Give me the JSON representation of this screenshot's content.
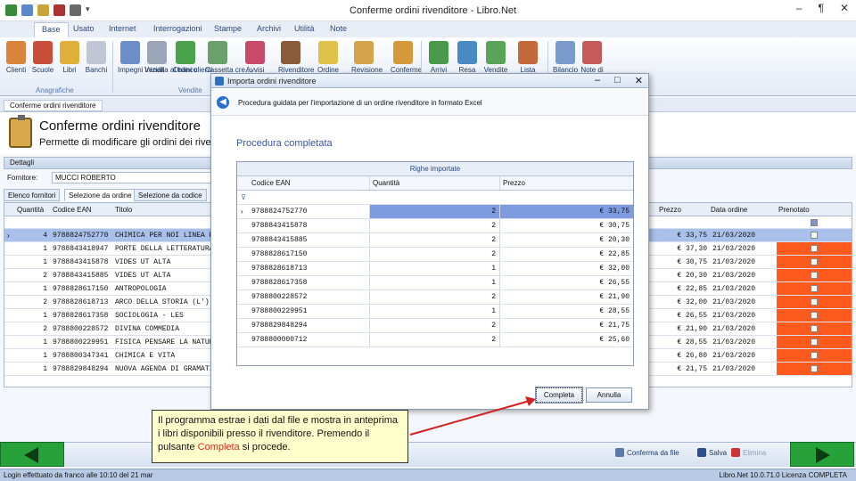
{
  "window": {
    "title": "Conferme ordini rivenditore - Libro.Net",
    "controls": [
      "–",
      "¶",
      "✕"
    ]
  },
  "ribbon": {
    "tabs": [
      "Base",
      "Usato",
      "Internet",
      "Interrogazioni",
      "Stampe",
      "Archivi",
      "Utilità",
      "Note"
    ],
    "groups": [
      {
        "label": "Anagrafiche",
        "buttons": [
          "Clienti",
          "Scuole",
          "Libri",
          "Banchi"
        ]
      },
      {
        "label": "Vendite",
        "buttons": [
          "Impegni iniziali",
          "Vendita al banco",
          "Ordini clienti",
          "Cassetta cre…",
          "Avvisi",
          "Rivenditore",
          "Ordine",
          "Revisione",
          "Conferme"
        ]
      },
      {
        "label": "",
        "buttons": [
          "Arrivi",
          "Resa",
          "Vendite",
          "Lista"
        ]
      },
      {
        "label": "",
        "buttons": [
          "Bilancio",
          "Note di"
        ]
      }
    ]
  },
  "doc_tab": "Conferme ordini rivenditore",
  "header": {
    "title": "Conferme ordini rivenditore",
    "subtitle": "Permette di modificare gli ordini dei rivenditori"
  },
  "details": {
    "section_label": "Dettagli",
    "fornitore_label": "Fornitore:",
    "fornitore_value": "MUCCI ROBERTO",
    "subtabs": [
      "Elenco fornitori",
      "Selezione da ordine",
      "Selezione da codice"
    ]
  },
  "main_grid": {
    "headers": [
      "Quantità",
      "Codice EAN",
      "Titolo",
      "Prezzo",
      "Data ordine",
      "Prenotato"
    ],
    "rows": [
      {
        "q": "4",
        "ean": "9788824752770",
        "title": "CHIMICA PER NOI LINEA BLU",
        "price": "€ 33,75",
        "date": "21/03/2020",
        "pren": false,
        "sel": true
      },
      {
        "q": "1",
        "ean": "9788843418947",
        "title": "PORTE DELLA LETTERATURA",
        "price": "€ 37,30",
        "date": "21/03/2020",
        "pren": true,
        "sel": false
      },
      {
        "q": "1",
        "ean": "9788843415878",
        "title": "VIDES UT ALTA",
        "price": "€ 30,75",
        "date": "21/03/2020",
        "pren": true,
        "sel": false
      },
      {
        "q": "2",
        "ean": "9788843415885",
        "title": "VIDES UT ALTA",
        "price": "€ 20,30",
        "date": "21/03/2020",
        "pren": true,
        "sel": false
      },
      {
        "q": "1",
        "ean": "9788828617150",
        "title": "ANTROPOLOGIA",
        "price": "€ 22,85",
        "date": "21/03/2020",
        "pren": true,
        "sel": false
      },
      {
        "q": "2",
        "ean": "9788828618713",
        "title": "ARCO DELLA STORIA (L')",
        "price": "€ 32,00",
        "date": "21/03/2020",
        "pren": true,
        "sel": false
      },
      {
        "q": "1",
        "ean": "9788828617358",
        "title": "SOCIOLOGIA - LES",
        "price": "€ 26,55",
        "date": "21/03/2020",
        "pren": true,
        "sel": false
      },
      {
        "q": "2",
        "ean": "9788800228572",
        "title": "DIVINA COMMEDIA",
        "price": "€ 21,90",
        "date": "21/03/2020",
        "pren": true,
        "sel": false
      },
      {
        "q": "1",
        "ean": "9788800229951",
        "title": "FISICA PENSARE LA NATURA",
        "price": "€ 28,55",
        "date": "21/03/2020",
        "pren": true,
        "sel": false
      },
      {
        "q": "1",
        "ean": "9788800347341",
        "title": "CHIMICA E VITA",
        "price": "€ 26,80",
        "date": "21/03/2020",
        "pren": true,
        "sel": false
      },
      {
        "q": "1",
        "ean": "9788829848294",
        "title": "NUOVA AGENDA DI GRAMATICA",
        "price": "€ 21,75",
        "date": "21/03/2020",
        "pren": true,
        "sel": false
      }
    ]
  },
  "modal": {
    "title": "Importa ordini rivenditore",
    "controls": [
      "–",
      "□",
      "✕"
    ],
    "wizard_text": "Procedura guidata per l'importazione di un ordine rivenditore in formato Excel",
    "status": "Procedura completata",
    "grid_band": "Righe importate",
    "headers": [
      "Codice EAN",
      "Quantità",
      "Prezzo"
    ],
    "rows": [
      {
        "ean": "9788824752770",
        "q": "2",
        "p": "€ 33,75"
      },
      {
        "ean": "9788843415878",
        "q": "2",
        "p": "€ 30,75"
      },
      {
        "ean": "9788843415885",
        "q": "2",
        "p": "€ 20,30"
      },
      {
        "ean": "9788828617150",
        "q": "2",
        "p": "€ 22,85"
      },
      {
        "ean": "9788828618713",
        "q": "1",
        "p": "€ 32,00"
      },
      {
        "ean": "9788828617358",
        "q": "1",
        "p": "€ 26,55"
      },
      {
        "ean": "9788800228572",
        "q": "2",
        "p": "€ 21,90"
      },
      {
        "ean": "9788800229951",
        "q": "1",
        "p": "€ 28,55"
      },
      {
        "ean": "9788829848294",
        "q": "2",
        "p": "€ 21,75"
      },
      {
        "ean": "9788800000712",
        "q": "2",
        "p": "€ 25,60"
      }
    ],
    "ok_button": "Completa",
    "cancel_button": "Annulla"
  },
  "bottom_toolbar": {
    "conferma": "Conferma da file",
    "salva": "Salva",
    "elimina": "Elimina"
  },
  "status_bar": {
    "left": "Login effettuato da franco alle 10:10 del 21 mar",
    "right": "Libro.Net 10.0.71.0 Licenza COMPLETA"
  },
  "callout": {
    "text_before": "Il programma estrae i dati dal file e mostra in anteprima i libri disponibili presso il rivenditore. Premendo il pulsante ",
    "highlight": "Completa",
    "text_after": " si procede."
  },
  "colors": {
    "accent": "#2f6fbf",
    "selected_row": "#a9c0ea",
    "prenotato_red": "#ff5a1e",
    "nav_green": "#27a23a",
    "arrow_red": "#d22020"
  }
}
